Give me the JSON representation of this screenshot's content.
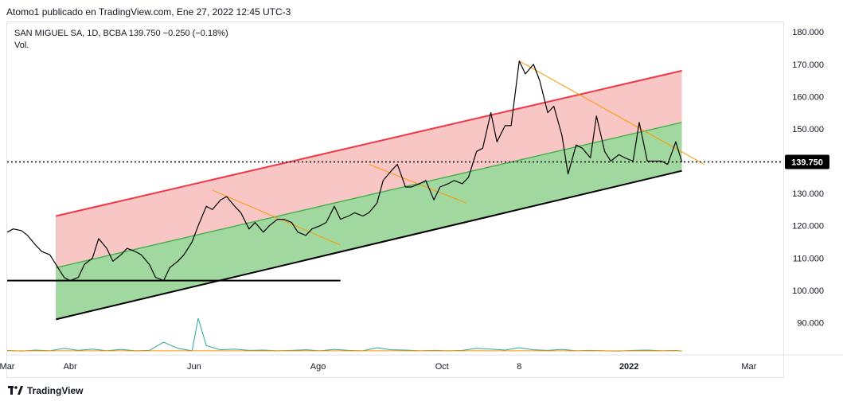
{
  "header": {
    "publisher": "Atomo1 publicado en TradingView.com, Ene 27, 2022 12:45 UTC-3"
  },
  "legend": {
    "symbol_line": "SAN MIGUEL SA, 1D, BCBA  139.750  −0.250 (−0.18%)",
    "volume_label": "Vol."
  },
  "footer": {
    "brand": "TradingView"
  },
  "colors": {
    "price": "#000000",
    "upper_line": "#f23645",
    "upper_fill": "#f8bcbc",
    "lower_fill": "#8fd18f",
    "mid_line": "#4caf50",
    "support": "#000000",
    "trend_orange": "#ff9800",
    "volume": "#26a69a",
    "volume_ma": "#ff9800",
    "last_price_bg": "#000000"
  },
  "chart_data": {
    "type": "line",
    "title": "SAN MIGUEL SA, 1D, BCBA",
    "last_price": 139.75,
    "last_price_label": "139.750",
    "ylim": [
      80,
      183
    ],
    "y_ticks": [
      {
        "value": 180,
        "label": "180.000"
      },
      {
        "value": 170,
        "label": "170.000"
      },
      {
        "value": 160,
        "label": "160.000"
      },
      {
        "value": 150,
        "label": "150.000"
      },
      {
        "value": 140,
        "label": "140.000"
      },
      {
        "value": 130,
        "label": "130.000"
      },
      {
        "value": 120,
        "label": "120.000"
      },
      {
        "value": 110,
        "label": "110.000"
      },
      {
        "value": 100,
        "label": "100.000"
      },
      {
        "value": 90,
        "label": "90.000"
      }
    ],
    "xlim": [
      "2021-03-01",
      "2022-03-14"
    ],
    "x_ticks": [
      {
        "date": "2021-03-01",
        "label": "Mar",
        "bold": false
      },
      {
        "date": "2021-04-01",
        "label": "Abr",
        "bold": false
      },
      {
        "date": "2021-06-01",
        "label": "Jun",
        "bold": false
      },
      {
        "date": "2021-08-01",
        "label": "Ago",
        "bold": false
      },
      {
        "date": "2021-10-01",
        "label": "Oct",
        "bold": false
      },
      {
        "date": "2021-11-08",
        "label": "8",
        "bold": false
      },
      {
        "date": "2022-01-01",
        "label": "2022",
        "bold": true
      },
      {
        "date": "2022-03-01",
        "label": "Mar",
        "bold": false
      }
    ],
    "series": [
      {
        "points": [
          [
            "2021-03-01",
            118
          ],
          [
            "2021-03-04",
            119
          ],
          [
            "2021-03-08",
            118.5
          ],
          [
            "2021-03-11",
            117
          ],
          [
            "2021-03-15",
            114
          ],
          [
            "2021-03-18",
            112
          ],
          [
            "2021-03-22",
            111
          ],
          [
            "2021-03-25",
            108
          ],
          [
            "2021-03-29",
            104
          ],
          [
            "2021-04-01",
            103
          ],
          [
            "2021-04-05",
            104
          ],
          [
            "2021-04-08",
            108
          ],
          [
            "2021-04-12",
            110
          ],
          [
            "2021-04-15",
            116
          ],
          [
            "2021-04-19",
            113
          ],
          [
            "2021-04-22",
            109
          ],
          [
            "2021-04-26",
            111
          ],
          [
            "2021-04-29",
            113
          ],
          [
            "2021-05-03",
            112
          ],
          [
            "2021-05-06",
            111
          ],
          [
            "2021-05-10",
            108
          ],
          [
            "2021-05-13",
            104
          ],
          [
            "2021-05-17",
            103
          ],
          [
            "2021-05-20",
            107
          ],
          [
            "2021-05-24",
            109
          ],
          [
            "2021-05-27",
            111
          ],
          [
            "2021-05-31",
            115
          ],
          [
            "2021-06-03",
            120
          ],
          [
            "2021-06-07",
            126
          ],
          [
            "2021-06-10",
            125
          ],
          [
            "2021-06-14",
            128
          ],
          [
            "2021-06-17",
            129
          ],
          [
            "2021-06-21",
            126
          ],
          [
            "2021-06-24",
            124
          ],
          [
            "2021-06-28",
            119
          ],
          [
            "2021-07-01",
            121
          ],
          [
            "2021-07-05",
            118
          ],
          [
            "2021-07-08",
            120
          ],
          [
            "2021-07-12",
            122
          ],
          [
            "2021-07-15",
            122
          ],
          [
            "2021-07-19",
            121
          ],
          [
            "2021-07-22",
            118
          ],
          [
            "2021-07-26",
            117
          ],
          [
            "2021-07-29",
            119
          ],
          [
            "2021-08-02",
            120
          ],
          [
            "2021-08-05",
            121
          ],
          [
            "2021-08-09",
            126
          ],
          [
            "2021-08-12",
            122
          ],
          [
            "2021-08-16",
            123
          ],
          [
            "2021-08-19",
            124
          ],
          [
            "2021-08-23",
            123
          ],
          [
            "2021-08-26",
            124
          ],
          [
            "2021-08-30",
            127
          ],
          [
            "2021-09-02",
            134
          ],
          [
            "2021-09-06",
            137
          ],
          [
            "2021-09-09",
            139
          ],
          [
            "2021-09-13",
            132
          ],
          [
            "2021-09-16",
            132
          ],
          [
            "2021-09-20",
            133
          ],
          [
            "2021-09-23",
            134
          ],
          [
            "2021-09-27",
            128
          ],
          [
            "2021-09-30",
            132
          ],
          [
            "2021-10-04",
            133
          ],
          [
            "2021-10-07",
            134
          ],
          [
            "2021-10-11",
            133
          ],
          [
            "2021-10-14",
            135
          ],
          [
            "2021-10-18",
            143
          ],
          [
            "2021-10-21",
            144
          ],
          [
            "2021-10-25",
            155
          ],
          [
            "2021-10-28",
            146
          ],
          [
            "2021-11-01",
            151
          ],
          [
            "2021-11-04",
            151
          ],
          [
            "2021-11-08",
            171
          ],
          [
            "2021-11-11",
            167
          ],
          [
            "2021-11-15",
            170
          ],
          [
            "2021-11-18",
            165
          ],
          [
            "2021-11-22",
            155
          ],
          [
            "2021-11-25",
            157
          ],
          [
            "2021-11-29",
            148
          ],
          [
            "2021-12-02",
            136
          ],
          [
            "2021-12-06",
            145
          ],
          [
            "2021-12-09",
            144
          ],
          [
            "2021-12-13",
            141
          ],
          [
            "2021-12-16",
            154
          ],
          [
            "2021-12-20",
            143
          ],
          [
            "2021-12-23",
            140
          ],
          [
            "2021-12-27",
            142
          ],
          [
            "2021-12-30",
            141
          ],
          [
            "2022-01-03",
            140
          ],
          [
            "2022-01-06",
            152
          ],
          [
            "2022-01-10",
            140
          ],
          [
            "2022-01-13",
            140
          ],
          [
            "2022-01-17",
            140
          ],
          [
            "2022-01-20",
            139
          ],
          [
            "2022-01-24",
            146
          ],
          [
            "2022-01-27",
            139.75
          ]
        ]
      }
    ],
    "volume": {
      "label": "Vol.",
      "points": [
        [
          "2021-03-01",
          0.06
        ],
        [
          "2021-03-08",
          0.04
        ],
        [
          "2021-03-15",
          0.07
        ],
        [
          "2021-03-22",
          0.05
        ],
        [
          "2021-03-29",
          0.12
        ],
        [
          "2021-04-05",
          0.06
        ],
        [
          "2021-04-12",
          0.1
        ],
        [
          "2021-04-19",
          0.05
        ],
        [
          "2021-04-26",
          0.09
        ],
        [
          "2021-05-03",
          0.05
        ],
        [
          "2021-05-10",
          0.06
        ],
        [
          "2021-05-17",
          0.3
        ],
        [
          "2021-05-24",
          0.12
        ],
        [
          "2021-05-31",
          0.05
        ],
        [
          "2021-06-03",
          1.0
        ],
        [
          "2021-06-07",
          0.2
        ],
        [
          "2021-06-14",
          0.08
        ],
        [
          "2021-06-21",
          0.1
        ],
        [
          "2021-06-28",
          0.06
        ],
        [
          "2021-07-05",
          0.07
        ],
        [
          "2021-07-12",
          0.05
        ],
        [
          "2021-07-19",
          0.06
        ],
        [
          "2021-07-26",
          0.08
        ],
        [
          "2021-08-02",
          0.05
        ],
        [
          "2021-08-09",
          0.09
        ],
        [
          "2021-08-16",
          0.06
        ],
        [
          "2021-08-23",
          0.05
        ],
        [
          "2021-08-30",
          0.14
        ],
        [
          "2021-09-06",
          0.08
        ],
        [
          "2021-09-13",
          0.07
        ],
        [
          "2021-09-20",
          0.05
        ],
        [
          "2021-09-27",
          0.06
        ],
        [
          "2021-10-04",
          0.05
        ],
        [
          "2021-10-11",
          0.06
        ],
        [
          "2021-10-18",
          0.12
        ],
        [
          "2021-10-25",
          0.1
        ],
        [
          "2021-11-01",
          0.07
        ],
        [
          "2021-11-08",
          0.14
        ],
        [
          "2021-11-15",
          0.08
        ],
        [
          "2021-11-22",
          0.06
        ],
        [
          "2021-11-29",
          0.09
        ],
        [
          "2021-12-06",
          0.05
        ],
        [
          "2021-12-13",
          0.06
        ],
        [
          "2021-12-20",
          0.05
        ],
        [
          "2021-12-27",
          0.04
        ],
        [
          "2022-01-03",
          0.06
        ],
        [
          "2022-01-10",
          0.07
        ],
        [
          "2022-01-17",
          0.05
        ],
        [
          "2022-01-24",
          0.06
        ],
        [
          "2022-01-27",
          0.04
        ]
      ],
      "ma_level": 0.05
    },
    "drawings": {
      "channel_lower": {
        "start": [
          "2021-03-25",
          91
        ],
        "end": [
          "2022-01-27",
          137
        ]
      },
      "channel_mid": {
        "start": [
          "2021-03-25",
          107
        ],
        "end": [
          "2022-01-27",
          152
        ]
      },
      "channel_upper": {
        "start": [
          "2021-03-25",
          123
        ],
        "end": [
          "2022-01-27",
          168
        ]
      },
      "support_line": {
        "start": [
          "2021-03-01",
          103
        ],
        "end": [
          "2021-08-12",
          103
        ]
      },
      "trend_lines": [
        {
          "start": [
            "2021-06-10",
            131
          ],
          "end": [
            "2021-08-12",
            114
          ]
        },
        {
          "start": [
            "2021-08-26",
            139
          ],
          "end": [
            "2021-10-13",
            127
          ]
        },
        {
          "start": [
            "2021-11-08",
            171
          ],
          "end": [
            "2022-02-07",
            139
          ]
        }
      ]
    }
  }
}
